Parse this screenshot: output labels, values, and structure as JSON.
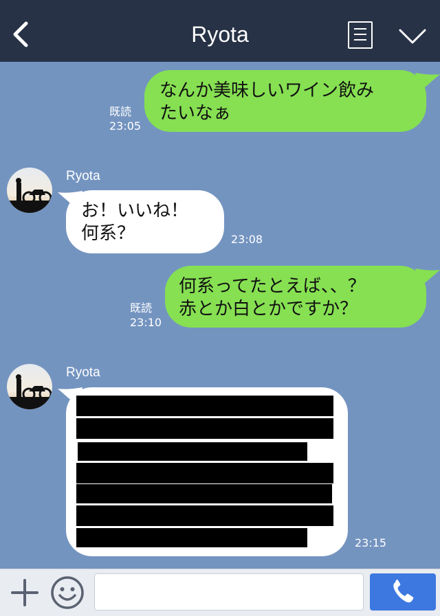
{
  "header": {
    "title": "Ryota",
    "back_icon": "chevron-left-icon",
    "menu_icon": "menu-icon",
    "collapse_icon": "chevron-down-icon"
  },
  "messages": [
    {
      "from": "me",
      "lines": [
        "なんか美味しいワイン飲み",
        "たいなぁ"
      ],
      "read": "既読",
      "time": "23:05"
    },
    {
      "from": "them",
      "sender": "Ryota",
      "lines": [
        "お！いいね！",
        "何系？"
      ],
      "time": "23:08"
    },
    {
      "from": "me",
      "lines": [
        "何系ってたとえば、、？",
        "赤とか白とかですか？"
      ],
      "read": "既読",
      "time": "23:10"
    },
    {
      "from": "them",
      "sender": "Ryota",
      "lines": [],
      "redacted": true,
      "time": "23:15"
    }
  ],
  "footer": {
    "input_placeholder": "",
    "plus_icon": "plus-icon",
    "emoji_icon": "smiley-icon",
    "call_icon": "phone-icon"
  },
  "colors": {
    "header": "#273246",
    "chat_background": "#7494c0",
    "my_bubble": "#86e052",
    "their_bubble": "#ffffff",
    "call_button": "#3c78e0"
  }
}
